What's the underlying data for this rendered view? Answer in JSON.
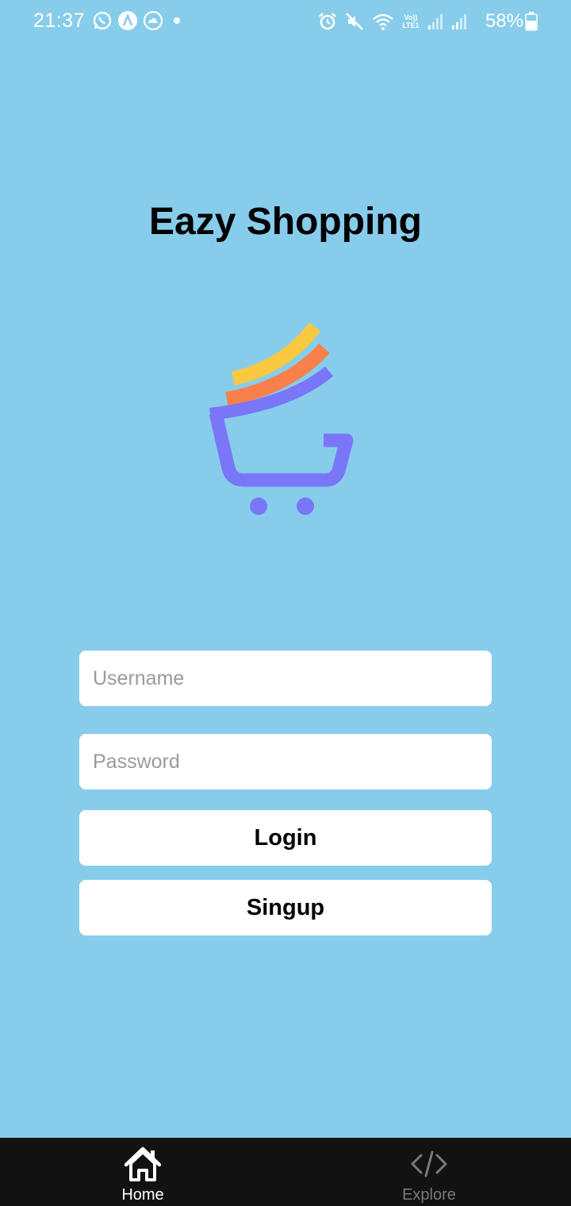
{
  "status_bar": {
    "time": "21:37",
    "battery_percent": "58%",
    "network_label": "Vo)) LTE1",
    "icons": [
      "whatsapp-icon",
      "app-a-icon",
      "cloud-icon",
      "dot-icon",
      "alarm-icon",
      "mute-icon",
      "wifi-icon",
      "signal-icon",
      "signal-icon",
      "battery-icon"
    ]
  },
  "app": {
    "title": "Eazy Shopping"
  },
  "form": {
    "username_placeholder": "Username",
    "password_placeholder": "Password",
    "login_label": "Login",
    "signup_label": "Singup"
  },
  "bottom_nav": {
    "items": [
      {
        "label": "Home",
        "icon": "home-icon",
        "active": true
      },
      {
        "label": "Explore",
        "icon": "code-icon",
        "active": false
      }
    ]
  },
  "colors": {
    "background": "#87CDEB",
    "logo_yellow": "#F9C940",
    "logo_orange": "#F9804A",
    "logo_purple": "#7A76F8",
    "nav_background": "#121212"
  }
}
